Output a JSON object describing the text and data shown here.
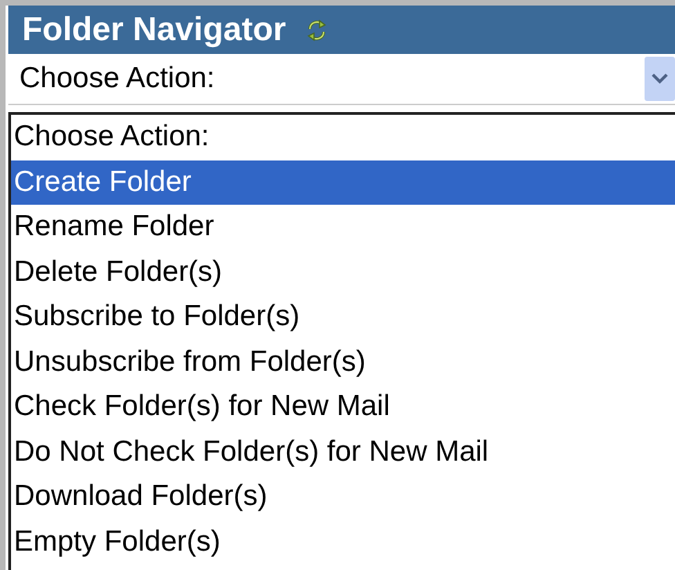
{
  "panel": {
    "title": "Folder Navigator"
  },
  "select": {
    "value": "Choose Action:",
    "expanded": true
  },
  "options": [
    {
      "label": "Choose Action:",
      "selected": false
    },
    {
      "label": "Create Folder",
      "selected": true
    },
    {
      "label": "Rename Folder",
      "selected": false
    },
    {
      "label": "Delete Folder(s)",
      "selected": false
    },
    {
      "label": "Subscribe to Folder(s)",
      "selected": false
    },
    {
      "label": "Unsubscribe from Folder(s)",
      "selected": false
    },
    {
      "label": "Check Folder(s) for New Mail",
      "selected": false
    },
    {
      "label": "Do Not Check Folder(s) for New Mail",
      "selected": false
    },
    {
      "label": "Download Folder(s)",
      "selected": false
    },
    {
      "label": "Empty Folder(s)",
      "selected": false
    }
  ]
}
